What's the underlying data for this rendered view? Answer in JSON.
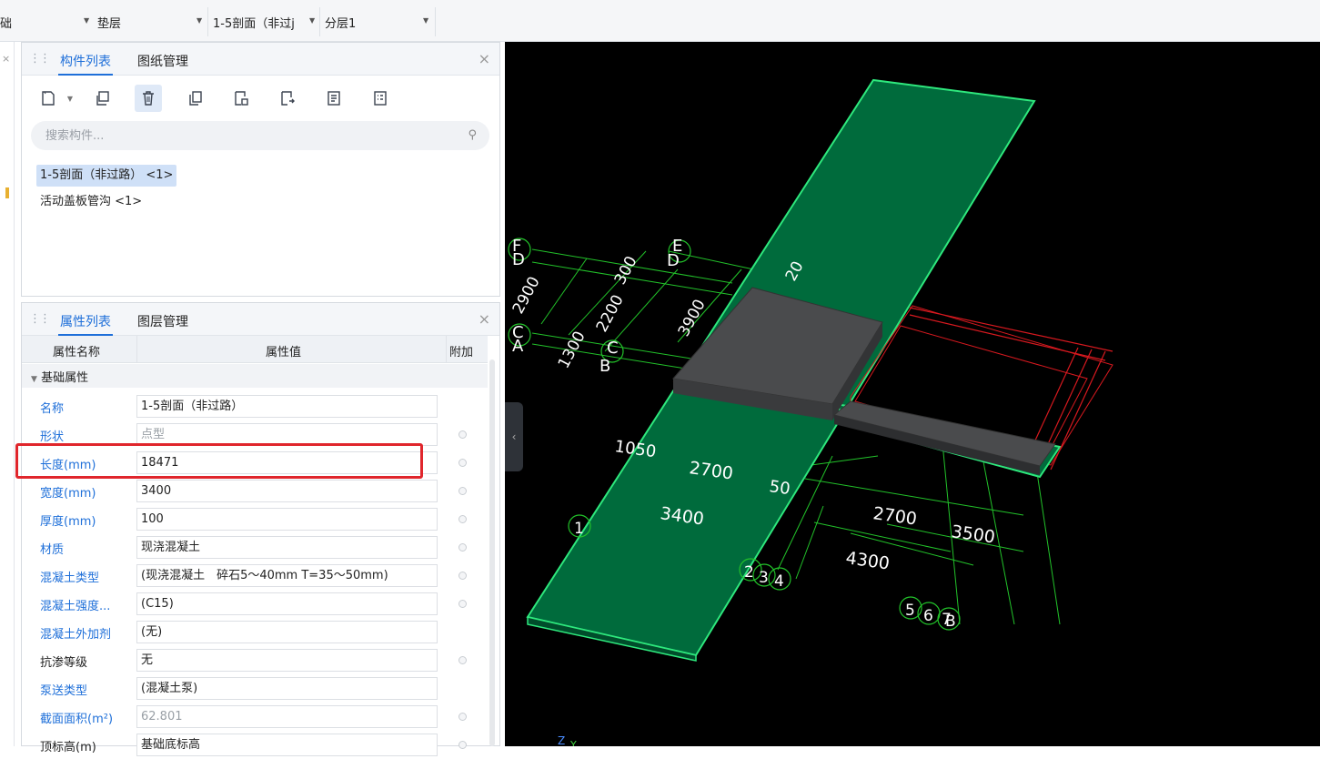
{
  "toolbar": {
    "seg1": "础",
    "seg2": "垫层",
    "seg3": "1-5剖面（非过j",
    "seg4": "分层1"
  },
  "component_panel": {
    "tabs": [
      "构件列表",
      "图纸管理"
    ],
    "search_placeholder": "搜索构件...",
    "items": [
      "1-5剖面（非过路） <1>",
      "活动盖板管沟 <1>"
    ],
    "close": "×"
  },
  "property_panel": {
    "tabs": [
      "属性列表",
      "图层管理"
    ],
    "close": "×",
    "headers": {
      "name": "属性名称",
      "value": "属性值",
      "extra": "附加"
    },
    "group": "基础属性",
    "rows": [
      {
        "name": "名称",
        "value": "1-5剖面（非过路）"
      },
      {
        "name": "形状",
        "value": "点型"
      },
      {
        "name": "长度(mm)",
        "value": "18471"
      },
      {
        "name": "宽度(mm)",
        "value": "3400"
      },
      {
        "name": "厚度(mm)",
        "value": "100"
      },
      {
        "name": "材质",
        "value": "现浇混凝土"
      },
      {
        "name": "混凝土类型",
        "value": "(现浇混凝土　碎石5～40mm  T=35～50mm)"
      },
      {
        "name": "混凝土强度...",
        "value": "(C15)"
      },
      {
        "name": "混凝土外加剂",
        "value": "(无)"
      },
      {
        "name": "抗渗等级",
        "value": "无"
      },
      {
        "name": "泵送类型",
        "value": "(混凝土泵)"
      },
      {
        "name": "截面面积(m²)",
        "value": "62.801"
      },
      {
        "name": "顶标高(m)",
        "value": "基础底标高"
      }
    ]
  },
  "viewport": {
    "labels": {
      "F": "F",
      "D": "D",
      "E": "E",
      "C": "C",
      "A": "A",
      "B": "B",
      "d2900": "2900",
      "d2200": "2200",
      "d300": "300",
      "d1300": "1300",
      "d3900": "3900",
      "d20": "20",
      "d1050": "1050",
      "d2700a": "2700",
      "d3400": "3400",
      "d50": "50",
      "d2700b": "2700",
      "d3500": "3500",
      "d4300": "4300",
      "n2": "2",
      "n3": "3",
      "n4": "4",
      "n5": "5",
      "n6": "6",
      "n7": "7",
      "n8": "8",
      "n1": "1",
      "axis_z": "Z",
      "axis_y": "Y"
    },
    "colors": {
      "slab": "#006b3c",
      "edge": "#2ee87d",
      "grey": "#4a4b4d",
      "red": "#d8191f",
      "dim": "#22c22a"
    }
  }
}
